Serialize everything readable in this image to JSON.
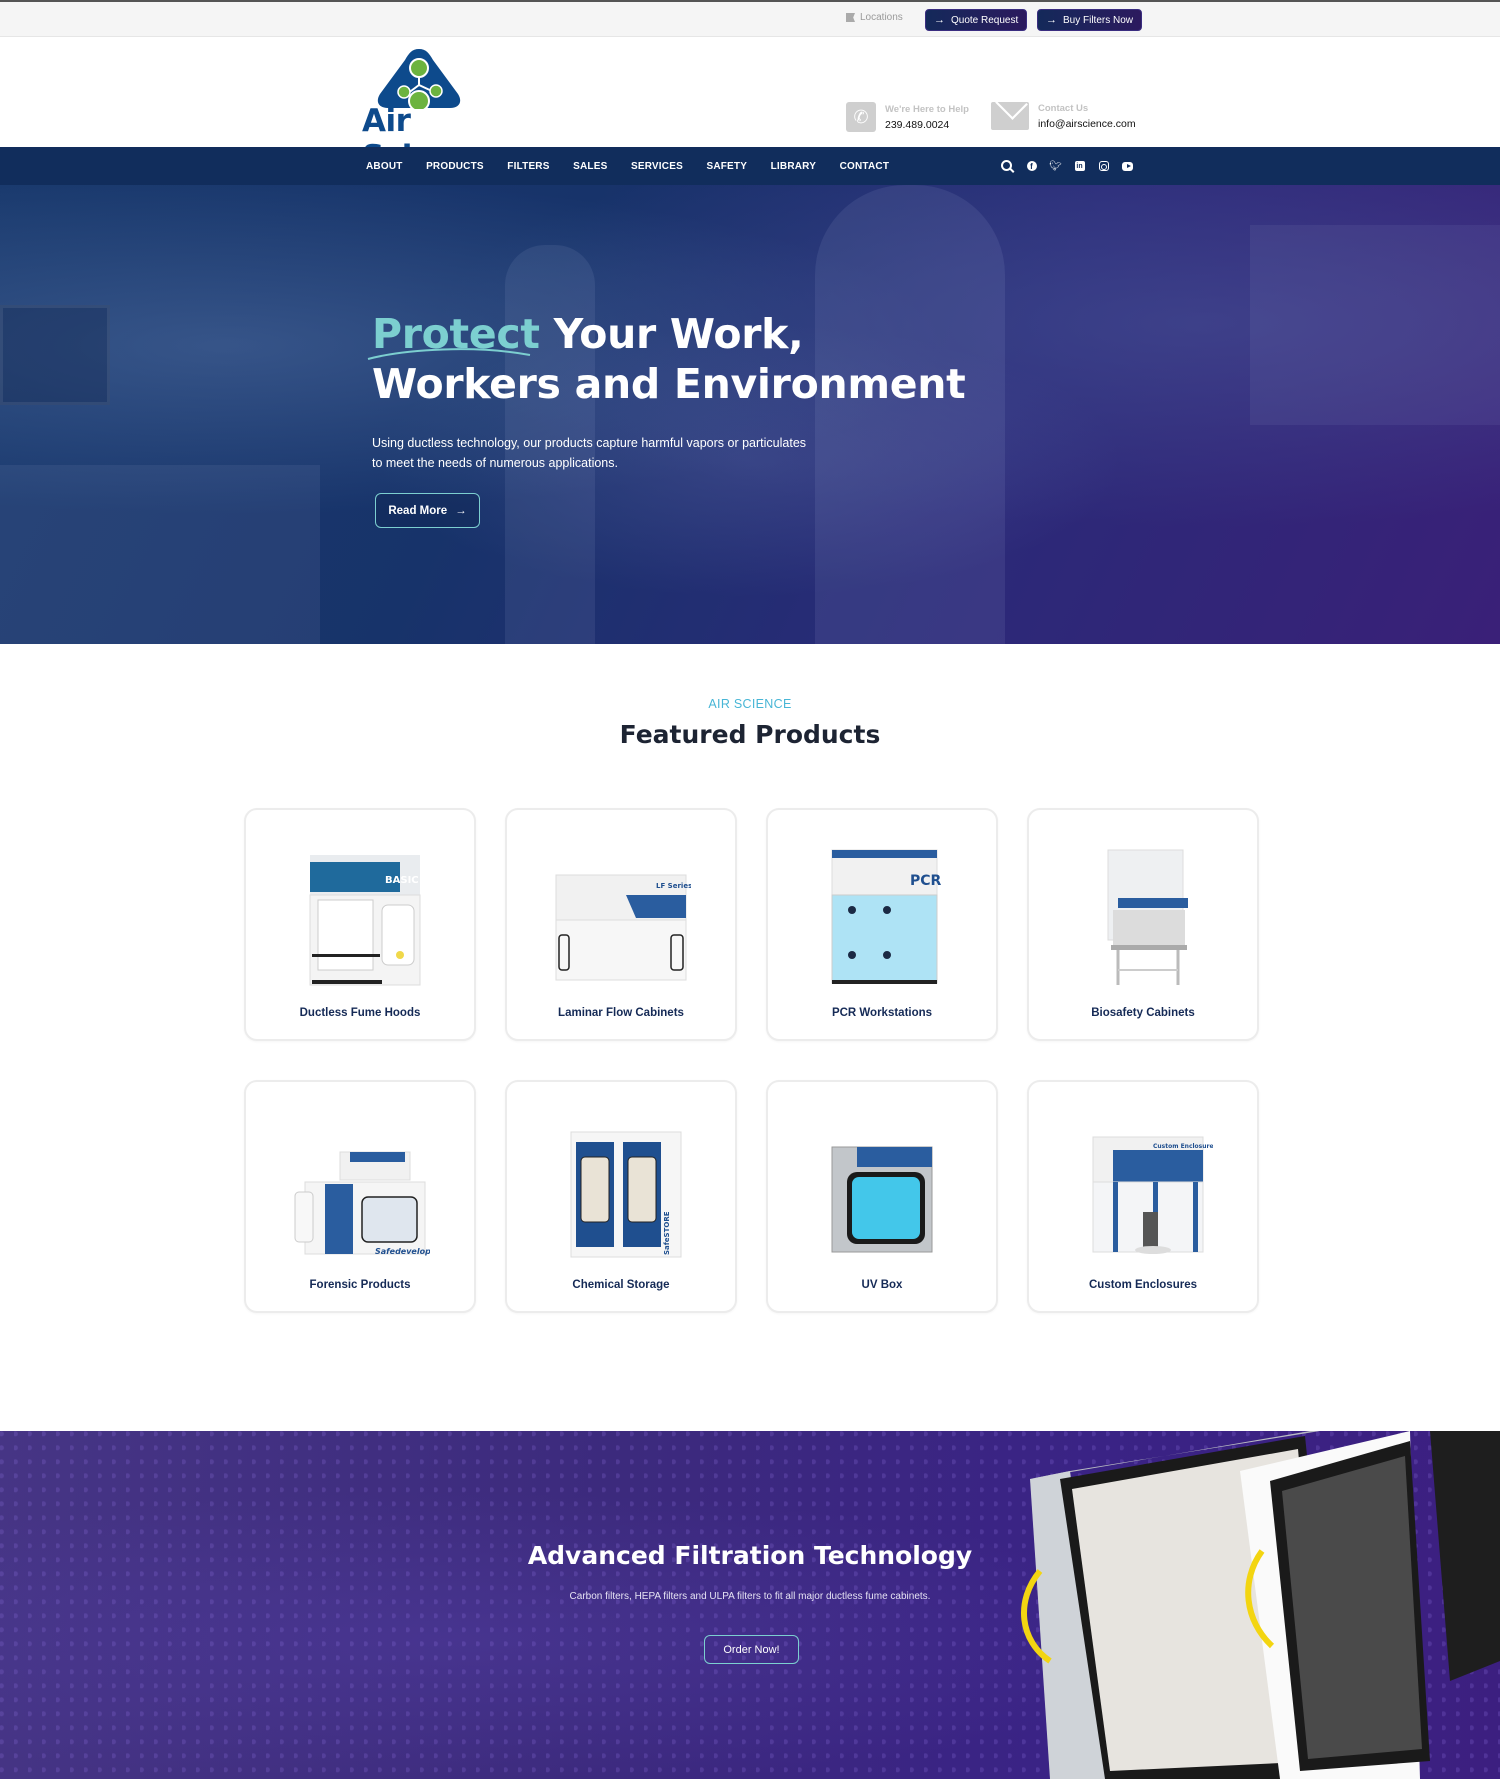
{
  "topbar": {
    "locations": "Locations",
    "quote_request": "Quote Request",
    "buy_filters": "Buy Filters Now"
  },
  "header": {
    "logo_text": "Air Science",
    "logo_mark": "®",
    "help_label": "We're Here to Help",
    "phone": "239.489.0024",
    "contact_label": "Contact Us",
    "email": "info@airscience.com"
  },
  "nav": {
    "items": [
      "ABOUT",
      "PRODUCTS",
      "FILTERS",
      "SALES",
      "SERVICES",
      "SAFETY",
      "LIBRARY",
      "CONTACT"
    ],
    "icons": [
      "search-icon",
      "facebook-icon",
      "twitter-icon",
      "linkedin-icon",
      "instagram-icon",
      "youtube-icon"
    ]
  },
  "hero": {
    "title_accent": "Protect",
    "title_rest_line1": " Your Work,",
    "title_line2": "Workers and Environment",
    "subtitle_line1": "Using ductless technology, our products capture harmful vapors or particulates",
    "subtitle_line2": "to meet the needs of numerous applications.",
    "button": "Read More"
  },
  "featured": {
    "eyebrow": "AIR SCIENCE",
    "title": "Featured Products",
    "products": [
      {
        "label": "Ductless Fume Hoods"
      },
      {
        "label": "Laminar Flow Cabinets"
      },
      {
        "label": "PCR Workstations"
      },
      {
        "label": "Biosafety Cabinets"
      },
      {
        "label": "Forensic Products"
      },
      {
        "label": "Chemical Storage"
      },
      {
        "label": "UV Box"
      },
      {
        "label": "Custom Enclosures"
      }
    ]
  },
  "promo": {
    "title": "Advanced Filtration Technology",
    "subtitle": "Carbon filters, HEPA filters and ULPA filters to fit all major ductless fume cabinets.",
    "button": "Order Now!"
  },
  "colors": {
    "navy": "#112d5c",
    "accent_teal": "#7ccfd0",
    "eyebrow_blue": "#48b6d6",
    "logo_blue": "#0d4a8c",
    "logo_green": "#6cb33f",
    "promo_purple": "#3c2a7d"
  }
}
